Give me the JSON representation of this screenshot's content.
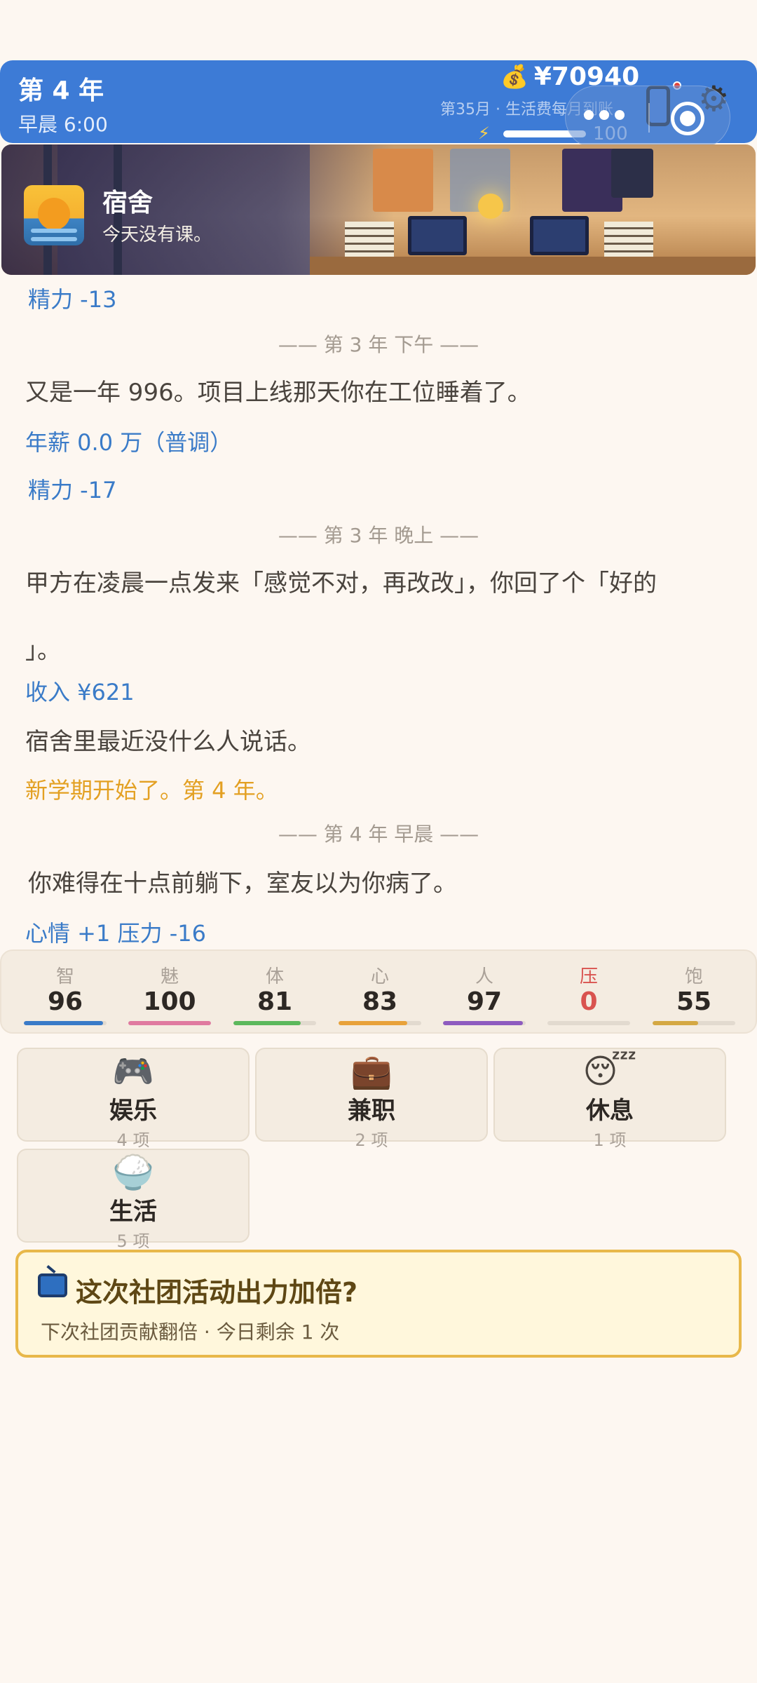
{
  "header": {
    "year": "第 4 年",
    "time": "早晨 6:00",
    "money": "¥70940",
    "money_icon": "money-bag-icon",
    "month_info": "第35月 · 生活费每月到账",
    "energy_value": "100",
    "energy_fraction": 1.0
  },
  "location": {
    "name": "宿舍",
    "subtitle": "今天没有课。",
    "icon": "sunrise-icon"
  },
  "log": [
    {
      "type": "blue",
      "text": "精力 -13"
    },
    {
      "type": "divider",
      "text": "—— 第 3 年 下午 ——"
    },
    {
      "type": "narr",
      "text": "又是一年 996。项目上线那天你在工位睡着了。"
    },
    {
      "type": "blue",
      "text": "年薪 0.0 万（普调）"
    },
    {
      "type": "blue",
      "text": "精力 -17"
    },
    {
      "type": "divider",
      "text": "—— 第 3 年 晚上 ——"
    },
    {
      "type": "narr",
      "text": "甲方在凌晨一点发来「感觉不对，再改改」，你回了个「好的"
    },
    {
      "type": "narr",
      "text": "」。"
    },
    {
      "type": "blue",
      "text": "收入 ¥621"
    },
    {
      "type": "narr",
      "text": "宿舍里最近没什么人说话。"
    },
    {
      "type": "orange",
      "text": "新学期开始了。第 4 年。"
    },
    {
      "type": "divider",
      "text": "—— 第 4 年 早晨 ——"
    },
    {
      "type": "narr",
      "text": "你难得在十点前躺下，室友以为你病了。"
    },
    {
      "type": "blue",
      "text": "心情 +1  压力 -16"
    }
  ],
  "stats": [
    {
      "label": "智",
      "value": "96",
      "fraction": 0.96,
      "color": "#3a7bc8",
      "label_color": "#aaa198",
      "value_color": "#2d2824"
    },
    {
      "label": "魅",
      "value": "100",
      "fraction": 1.0,
      "color": "#e07aa0",
      "label_color": "#aaa198",
      "value_color": "#2d2824"
    },
    {
      "label": "体",
      "value": "81",
      "fraction": 0.81,
      "color": "#5cb85c",
      "label_color": "#aaa198",
      "value_color": "#2d2824"
    },
    {
      "label": "心",
      "value": "83",
      "fraction": 0.83,
      "color": "#e8a23a",
      "label_color": "#aaa198",
      "value_color": "#2d2824"
    },
    {
      "label": "人",
      "value": "97",
      "fraction": 0.97,
      "color": "#8e5bbf",
      "label_color": "#aaa198",
      "value_color": "#2d2824"
    },
    {
      "label": "压",
      "value": "0",
      "fraction": 0.0,
      "color": "#d9534f",
      "label_color": "#d9534f",
      "value_color": "#d9534f"
    },
    {
      "label": "饱",
      "value": "55",
      "fraction": 0.55,
      "color": "#d4a843",
      "label_color": "#aaa198",
      "value_color": "#2d2824"
    }
  ],
  "actions": [
    {
      "name": "娱乐",
      "count": "4 项",
      "icon": "game-controller-icon",
      "glyph": "🎮"
    },
    {
      "name": "兼职",
      "count": "2 项",
      "icon": "briefcase-icon",
      "glyph": "💼"
    },
    {
      "name": "休息",
      "count": "1 项",
      "icon": "sleeping-face-icon",
      "glyph": "😴"
    },
    {
      "name": "生活",
      "count": "5 项",
      "icon": "rice-bowl-icon",
      "glyph": "🍚"
    }
  ],
  "ad": {
    "title": "这次社团活动出力加倍?",
    "subtitle": "下次社团贡献翻倍 · 今日剩余 1 次",
    "icon": "tv-icon"
  }
}
